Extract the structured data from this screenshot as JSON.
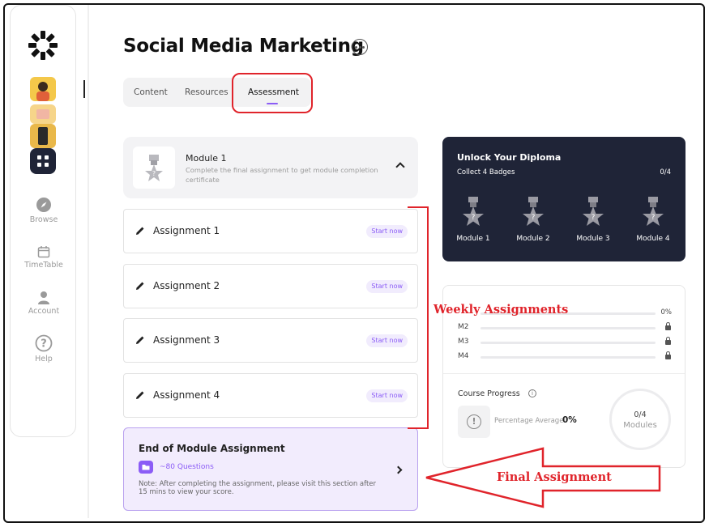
{
  "sidebar": {
    "nav": [
      {
        "label": "Browse",
        "icon": "compass-icon"
      },
      {
        "label": "TimeTable",
        "icon": "calendar-icon"
      },
      {
        "label": "Account",
        "icon": "user-icon"
      },
      {
        "label": "Help",
        "icon": "help-icon"
      }
    ]
  },
  "header": {
    "title": "Social Media Marketing"
  },
  "tabs": [
    {
      "label": "Content"
    },
    {
      "label": "Resources"
    },
    {
      "label": "Assessment",
      "active": true
    }
  ],
  "module": {
    "title": "Module 1",
    "description": "Complete the final assignment to get module completion certificate"
  },
  "assignments": [
    {
      "label": "Assignment 1",
      "action": "Start now"
    },
    {
      "label": "Assignment 2",
      "action": "Start now"
    },
    {
      "label": "Assignment 3",
      "action": "Start now"
    },
    {
      "label": "Assignment 4",
      "action": "Start now"
    }
  ],
  "final_assignment": {
    "title": "End of Module Assignment",
    "questions": "~80 Questions",
    "note": "Note: After completing the assignment, please visit this section after 15 mins to view your score."
  },
  "diploma": {
    "title": "Unlock Your Diploma",
    "subtitle": "Collect 4 Badges",
    "count": "0/4",
    "badges": [
      {
        "label": "Module 1"
      },
      {
        "label": "Module 2"
      },
      {
        "label": "Module 3"
      },
      {
        "label": "Module 4"
      }
    ]
  },
  "progress": {
    "modules": [
      {
        "label": "",
        "right": "0%",
        "locked": false
      },
      {
        "label": "M2",
        "locked": true
      },
      {
        "label": "M3",
        "locked": true
      },
      {
        "label": "M4",
        "locked": true
      }
    ],
    "course_progress_title": "Course Progress",
    "percentage_label": "Percentage Average",
    "percentage_value": "0%",
    "modules_count": "0/4",
    "modules_label": "Modules"
  },
  "annotations": {
    "weekly": "Weekly Assignments",
    "final": "Final Assignment"
  },
  "colors": {
    "accent": "#8b5cf6",
    "dark_panel": "#1f2437",
    "annotation": "#e0242b"
  }
}
